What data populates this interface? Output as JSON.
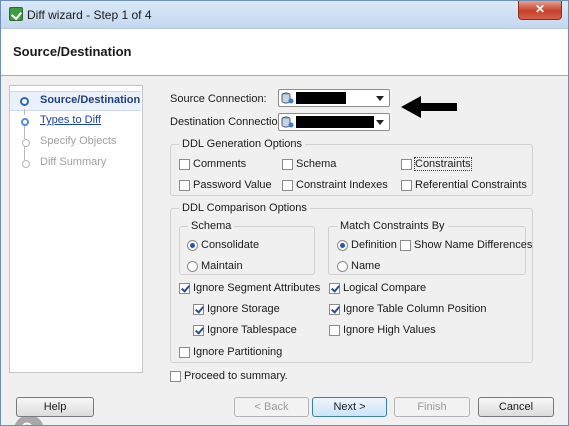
{
  "window": {
    "title": "Diff wizard - Step 1 of 4",
    "close_glyph": "✕"
  },
  "header": {
    "title": "Source/Destination"
  },
  "steps": [
    {
      "label": "Source/Destination",
      "state": "current"
    },
    {
      "label": "Types to Diff",
      "state": "link"
    },
    {
      "label": "Specify Objects",
      "state": "disabled"
    },
    {
      "label": "Diff Summary",
      "state": "disabled"
    }
  ],
  "connections": {
    "source_label": "Source Connection:",
    "destination_label": "Destination Connection:",
    "source_value": "",
    "destination_value": "",
    "icon": "database-connection-icon"
  },
  "ddl_generation": {
    "legend": "DDL Generation Options",
    "options": [
      {
        "label": "Comments",
        "checked": false
      },
      {
        "label": "Schema",
        "checked": false
      },
      {
        "label": "Constraints",
        "checked": false
      },
      {
        "label": "Password Value",
        "checked": false
      },
      {
        "label": "Constraint Indexes",
        "checked": false
      },
      {
        "label": "Referential Constraints",
        "checked": false
      }
    ]
  },
  "ddl_comparison": {
    "legend": "DDL Comparison Options",
    "schema": {
      "legend": "Schema",
      "consolidate": "Consolidate",
      "maintain": "Maintain",
      "selected": "Consolidate"
    },
    "match": {
      "legend": "Match Constraints By",
      "definition": "Definition",
      "name": "Name",
      "show_name_diff": "Show Name Differences",
      "selected": "Definition",
      "show_name_diff_checked": false
    },
    "options": [
      {
        "label": "Ignore Segment Attributes",
        "checked": true
      },
      {
        "label": "Ignore Storage",
        "checked": true
      },
      {
        "label": "Ignore Tablespace",
        "checked": true
      },
      {
        "label": "Ignore Partitioning",
        "checked": false
      },
      {
        "label": "Logical Compare",
        "checked": true
      },
      {
        "label": "Ignore Table Column Position",
        "checked": true
      },
      {
        "label": "Ignore High Values",
        "checked": false
      }
    ]
  },
  "proceed": {
    "label": "Proceed to summary.",
    "checked": false
  },
  "buttons": {
    "help": "Help",
    "back": "< Back",
    "next": "Next >",
    "finish": "Finish",
    "cancel": "Cancel"
  }
}
